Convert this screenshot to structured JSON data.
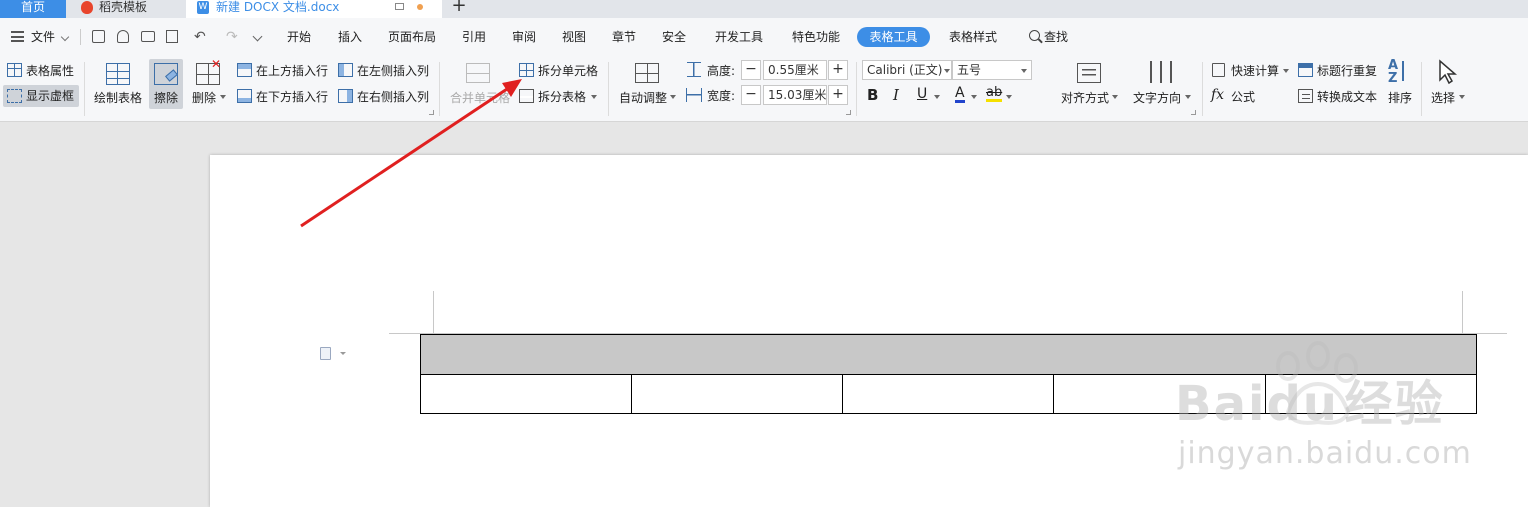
{
  "tabs": {
    "home": "首页",
    "template": "稻壳模板",
    "document": "新建 DOCX 文档.docx",
    "add": "+"
  },
  "menu": {
    "file": "文件",
    "items": [
      "开始",
      "插入",
      "页面布局",
      "引用",
      "审阅",
      "视图",
      "章节",
      "安全",
      "开发工具",
      "特色功能",
      "表格工具",
      "表格样式"
    ],
    "active": "表格工具",
    "search": "查找"
  },
  "ribbon": {
    "table_props": "表格属性",
    "show_gridlines": "显示虚框",
    "draw_table": "绘制表格",
    "erase": "擦除",
    "delete": "删除",
    "insert_above": "在上方插入行",
    "insert_below": "在下方插入行",
    "insert_left": "在左侧插入列",
    "insert_right": "在右侧插入列",
    "merge_cells": "合并单元格",
    "split_cells": "拆分单元格",
    "split_table": "拆分表格",
    "auto_fit": "自动调整",
    "height_label": "高度:",
    "height_value": "0.55厘米",
    "width_label": "宽度:",
    "width_value": "15.03厘米",
    "font_name": "Calibri (正文)",
    "font_size": "五号",
    "bold": "B",
    "italic": "I",
    "underline": "U",
    "font_color": "A",
    "highlight": "ab",
    "align": "对齐方式",
    "text_direction": "文字方向",
    "quick_calc": "快速计算",
    "formula": "公式",
    "formula_icon": "fx",
    "title_repeat": "标题行重复",
    "to_text": "转换成文本",
    "sort": "排序",
    "select": "选择"
  },
  "watermark": {
    "brand": "Bai",
    "brand2": "du",
    "brand3": "经验",
    "url": "jingyan.baidu.com"
  },
  "colors": {
    "accent": "#3d8ee6",
    "arrow": "#e02020",
    "header_cell": "#c8c8c8"
  }
}
